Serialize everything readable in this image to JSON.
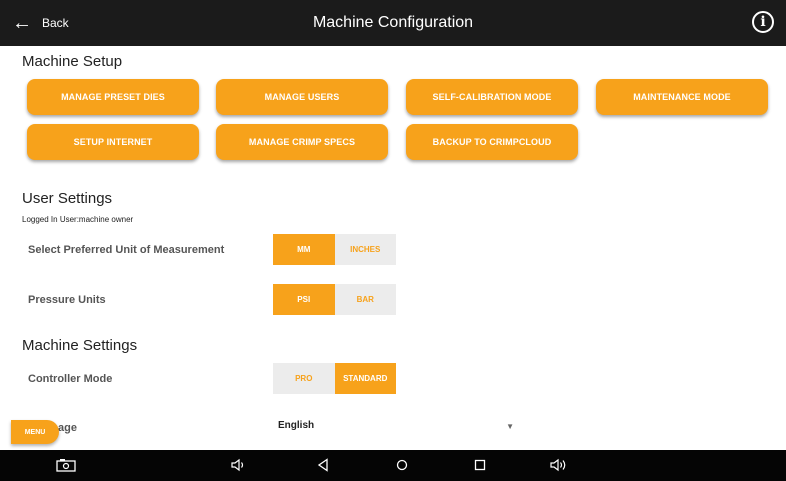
{
  "header": {
    "back_label": "Back",
    "title": "Machine Configuration",
    "info_icon": "info-icon"
  },
  "machine_setup": {
    "title": "Machine Setup",
    "buttons": [
      "MANAGE PRESET DIES",
      "MANAGE USERS",
      "SELF-CALIBRATION MODE",
      "MAINTENANCE MODE",
      "SETUP INTERNET",
      "MANAGE CRIMP SPECS",
      "BACKUP TO CRIMPCLOUD"
    ]
  },
  "user_settings": {
    "title": "User Settings",
    "logged_in": "Logged In User:machine owner",
    "unit_label": "Select Preferred Unit of Measurement",
    "unit_options": [
      "MM",
      "INCHES"
    ],
    "unit_selected": "MM",
    "pressure_label": "Pressure Units",
    "pressure_options": [
      "PSI",
      "BAR"
    ],
    "pressure_selected": "PSI"
  },
  "machine_settings": {
    "title": "Machine Settings",
    "controller_label": "Controller Mode",
    "controller_options": [
      "PRO",
      "STANDARD"
    ],
    "controller_selected": "STANDARD",
    "language_label_visible": "age",
    "language_value": "English"
  },
  "menu_label": "MENU",
  "colors": {
    "accent": "#f7a21b",
    "topbar": "#1b1b1b",
    "navbar": "#050505",
    "toggle_off": "#ececec"
  },
  "nav_icons": [
    "screenshot-icon",
    "volume-down-icon",
    "back-icon",
    "home-icon",
    "recents-icon",
    "volume-up-icon"
  ]
}
